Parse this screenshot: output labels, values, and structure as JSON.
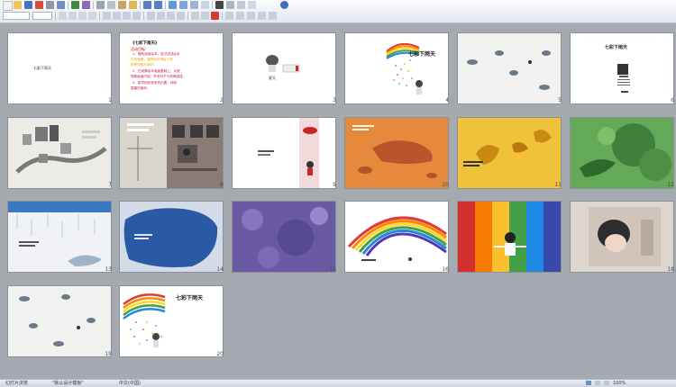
{
  "toolbar": {
    "font_size": "12",
    "zoom": "100%"
  },
  "slides": [
    {
      "num": "1",
      "title": "七彩下雨天"
    },
    {
      "num": "2",
      "title": "《七彩下雨天》",
      "subtitle": "活动目标：",
      "lines": [
        "1、借助阅读绘本，尝试讲述绘本",
        "中的画面，感受色彩带给人的",
        "奇思妙想与美好。",
        "2、在观察绘本画面基础上，大胆",
        "想象画面内容，学说句子与简单描述。",
        "3、愿意色彩带来的乐趣，体验",
        "童趣的美好。"
      ]
    },
    {
      "num": "3",
      "caption": "夏天"
    },
    {
      "num": "4",
      "title": "七彩下雨天"
    },
    {
      "num": "5"
    },
    {
      "num": "6",
      "title": "七彩下雨天"
    },
    {
      "num": "7"
    },
    {
      "num": "8"
    },
    {
      "num": "9"
    },
    {
      "num": "10"
    },
    {
      "num": "11"
    },
    {
      "num": "12"
    },
    {
      "num": "13"
    },
    {
      "num": "14"
    },
    {
      "num": "15"
    },
    {
      "num": "16"
    },
    {
      "num": "17"
    },
    {
      "num": "18"
    },
    {
      "num": "19"
    },
    {
      "num": "20",
      "title": "七彩下雨天"
    }
  ],
  "status": {
    "slide_sorter": "幻灯片浏览",
    "theme": "\"默认设计模板\"",
    "lang": "中文(中国)",
    "zoom": "100%"
  }
}
